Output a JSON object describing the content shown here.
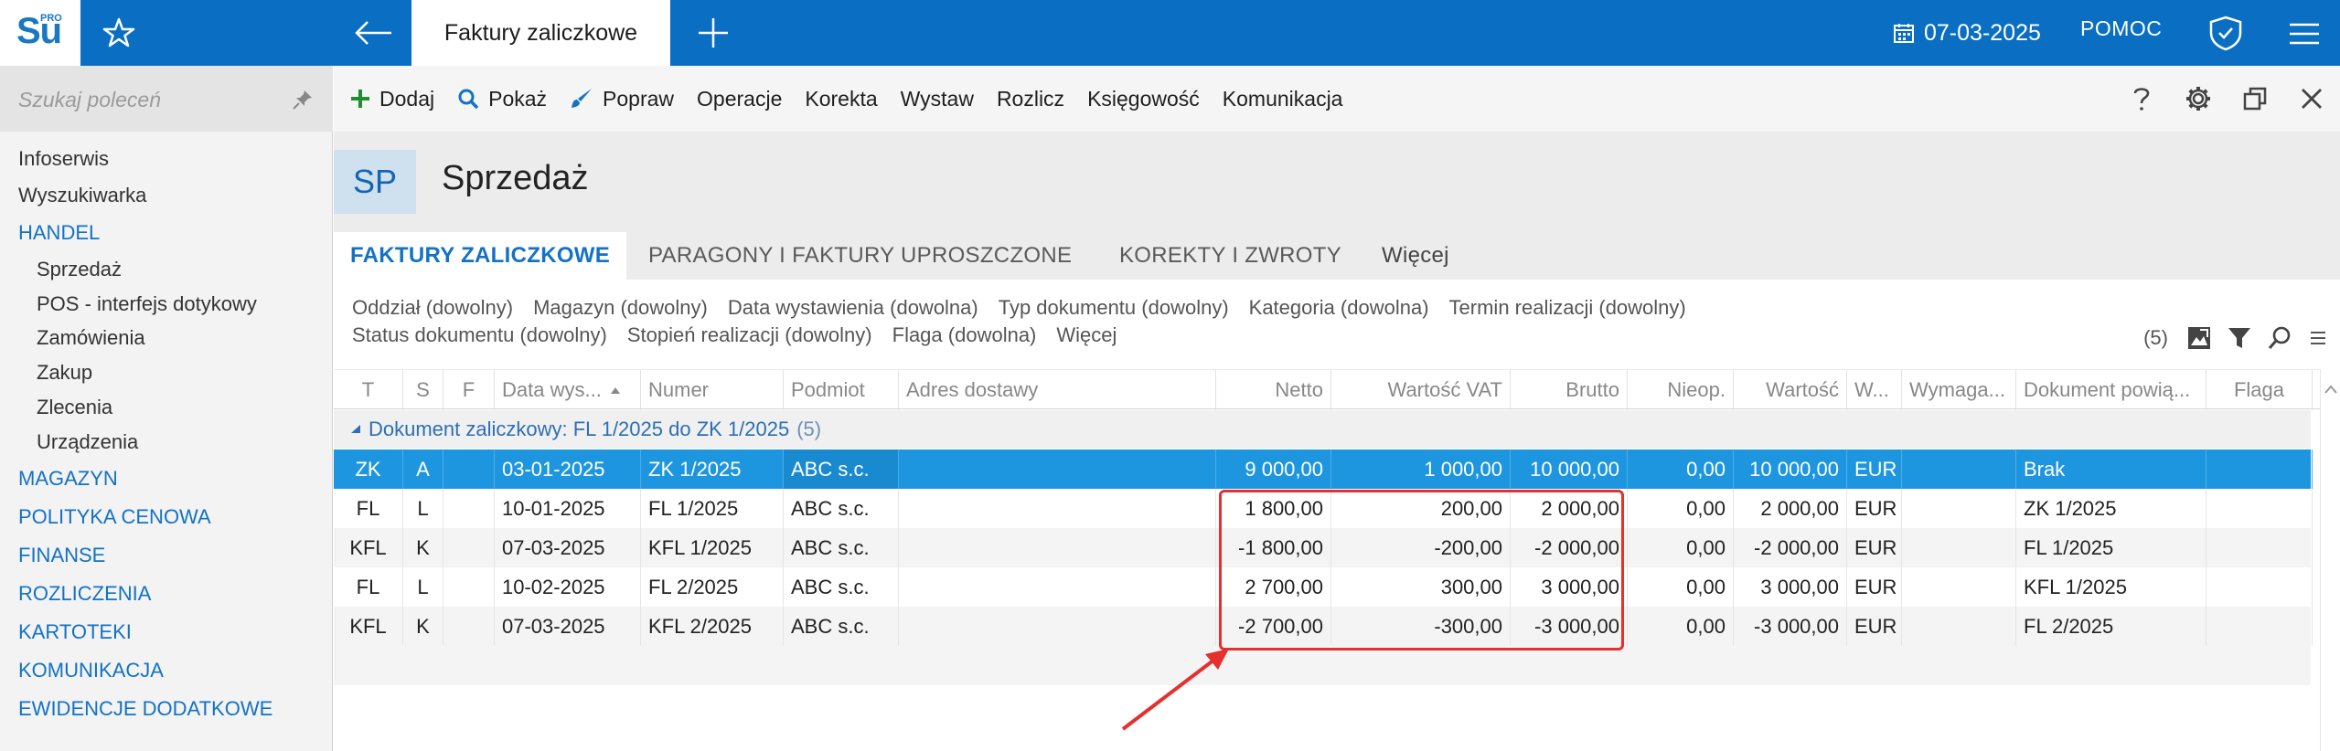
{
  "app": {
    "logo_text": "Su",
    "logo_badge": "PRO",
    "active_tab": "Faktury zaliczkowe",
    "date": "07-03-2025",
    "help": "POMOC"
  },
  "sidebar": {
    "search_placeholder": "Szukaj poleceń",
    "items": [
      {
        "label": "Infoserwis",
        "kind": "item"
      },
      {
        "label": "Wyszukiwarka",
        "kind": "item"
      },
      {
        "label": "HANDEL",
        "kind": "section"
      },
      {
        "label": "Sprzedaż",
        "kind": "sub"
      },
      {
        "label": "POS - interfejs dotykowy",
        "kind": "sub"
      },
      {
        "label": "Zamówienia",
        "kind": "sub"
      },
      {
        "label": "Zakup",
        "kind": "sub"
      },
      {
        "label": "Zlecenia",
        "kind": "sub"
      },
      {
        "label": "Urządzenia",
        "kind": "sub"
      },
      {
        "label": "MAGAZYN",
        "kind": "section"
      },
      {
        "label": "POLITYKA CENOWA",
        "kind": "section"
      },
      {
        "label": "FINANSE",
        "kind": "section"
      },
      {
        "label": "ROZLICZENIA",
        "kind": "section"
      },
      {
        "label": "KARTOTEKI",
        "kind": "section"
      },
      {
        "label": "KOMUNIKACJA",
        "kind": "section"
      },
      {
        "label": "EWIDENCJE DODATKOWE",
        "kind": "section"
      }
    ]
  },
  "toolbar": {
    "add": "Dodaj",
    "show": "Pokaż",
    "edit": "Popraw",
    "operations": "Operacje",
    "correction": "Korekta",
    "issue": "Wystaw",
    "settle": "Rozlicz",
    "accounting": "Księgowość",
    "communication": "Komunikacja"
  },
  "header": {
    "badge": "SP",
    "title": "Sprzedaż"
  },
  "tabs": [
    "FAKTURY ZALICZKOWE",
    "PARAGONY I FAKTURY UPROSZCZONE",
    "KOREKTY I ZWROTY",
    "Więcej"
  ],
  "filters": {
    "row1": [
      "Oddział (dowolny)",
      "Magazyn (dowolny)",
      "Data wystawienia (dowolna)",
      "Typ dokumentu (dowolny)",
      "Kategoria (dowolna)",
      "Termin realizacji (dowolny)"
    ],
    "row2": [
      "Status dokumentu (dowolny)",
      "Stopień realizacji (dowolny)",
      "Flaga (dowolna)",
      "Więcej"
    ],
    "count": "(5)"
  },
  "grid": {
    "columns": [
      "T",
      "S",
      "F",
      "Data wys...",
      "Numer",
      "Podmiot",
      "Adres dostawy",
      "Netto",
      "Wartość VAT",
      "Brutto",
      "Nieop.",
      "Wartość",
      "W...",
      "Wymaga...",
      "Dokument powią...",
      "Flaga"
    ],
    "group_label": "Dokument zaliczkowy: FL 1/2025 do ZK 1/2025",
    "group_count": "(5)",
    "rows": [
      {
        "t": "ZK",
        "s": "A",
        "date": "03-01-2025",
        "number": "ZK 1/2025",
        "party": "ABC s.c.",
        "netto": "9 000,00",
        "vat": "1 000,00",
        "brutto": "10 000,00",
        "unpaid": "0,00",
        "value": "10 000,00",
        "currency": "EUR",
        "linked": "Brak"
      },
      {
        "t": "FL",
        "s": "L",
        "date": "10-01-2025",
        "number": "FL 1/2025",
        "party": "ABC s.c.",
        "netto": "1 800,00",
        "vat": "200,00",
        "brutto": "2 000,00",
        "unpaid": "0,00",
        "value": "2 000,00",
        "currency": "EUR",
        "linked": "ZK 1/2025"
      },
      {
        "t": "KFL",
        "s": "K",
        "date": "07-03-2025",
        "number": "KFL 1/2025",
        "party": "ABC s.c.",
        "netto": "-1 800,00",
        "vat": "-200,00",
        "brutto": "-2 000,00",
        "unpaid": "0,00",
        "value": "-2 000,00",
        "currency": "EUR",
        "linked": "FL 1/2025"
      },
      {
        "t": "FL",
        "s": "L",
        "date": "10-02-2025",
        "number": "FL 2/2025",
        "party": "ABC s.c.",
        "netto": "2 700,00",
        "vat": "300,00",
        "brutto": "3 000,00",
        "unpaid": "0,00",
        "value": "3 000,00",
        "currency": "EUR",
        "linked": "KFL 1/2025"
      },
      {
        "t": "KFL",
        "s": "K",
        "date": "07-03-2025",
        "number": "KFL 2/2025",
        "party": "ABC s.c.",
        "netto": "-2 700,00",
        "vat": "-300,00",
        "brutto": "-3 000,00",
        "unpaid": "0,00",
        "value": "-3 000,00",
        "currency": "EUR",
        "linked": "FL 2/2025"
      }
    ]
  },
  "colors": {
    "brand": "#0a6fc2",
    "selection": "#1e96df",
    "section": "#1372c6",
    "highlight": "#e53030"
  }
}
